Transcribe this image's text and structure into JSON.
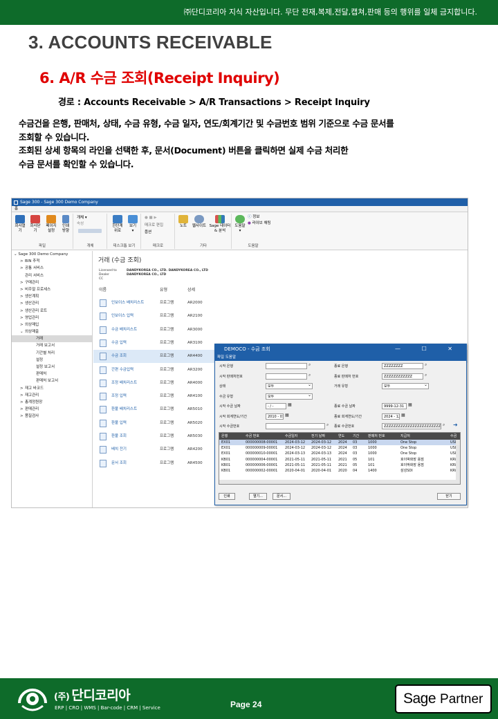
{
  "header": {
    "notice": "㈜단디코리아 지식 자산입니다. 무단 전재,복제,전달,캡쳐,판매 등의 행위를 일체 금지합니다.",
    "section_title": "3. ACCOUNTS RECEIVABLE",
    "sub_title": "6. A/R 수금 조회(Receipt Inquiry)",
    "path": "경로 : Accounts Receivable  > A/R Transactions > Receipt Inquiry",
    "description": [
      "수금건을 은행, 판매처, 상태, 수금 유형, 수금 일자, 연도/회계기간 및 수금번호 범위 기준으로 수금 문서를",
      "조회할 수 있습니다.",
      "조회된 상세 항목의 라인을 선택한 후, 문서(Document) 버튼을 클릭하면 실제 수금 처리한",
      "수금 문서를 확인할 수 있습니다."
    ]
  },
  "app": {
    "window_title": "Sage 300 - Sage 300 Demo Company",
    "menu_tab": "홈",
    "ribbon": {
      "buttons": [
        {
          "label": "회사열기"
        },
        {
          "label": "회사닫기"
        },
        {
          "label": "페이지\n설정"
        },
        {
          "label": "인쇄\n방향"
        },
        {
          "label": "개체 ▾"
        },
        {
          "label": "속성"
        },
        {
          "label": "한단계\n위로"
        },
        {
          "label": "보기\n▾"
        },
        {
          "label": "매크로 편집"
        },
        {
          "label": "옵션"
        },
        {
          "label": "노트"
        },
        {
          "label": "웹사이트"
        },
        {
          "label": "Sage 데이터\n& 분석"
        },
        {
          "label": "도움말\n▾"
        },
        {
          "label": "정보"
        },
        {
          "label": "라이브 채팅"
        }
      ],
      "groups": [
        "파일",
        "개체",
        "데스크톱 보기",
        "매크로",
        "기타",
        "도움말"
      ]
    },
    "tree": {
      "root": "Sage 300 Demo Company",
      "items": [
        {
          "label": "BIN 추적",
          "level": 1,
          "expand": ">"
        },
        {
          "label": "공통 서비스",
          "level": 1,
          "expand": ">"
        },
        {
          "label": "관리 서비스",
          "level": 1,
          "expand": ""
        },
        {
          "label": "구매관리",
          "level": 1,
          "expand": ">"
        },
        {
          "label": "비주얼 프로세스",
          "level": 1,
          "expand": ">"
        },
        {
          "label": "생산계획",
          "level": 1,
          "expand": ">"
        },
        {
          "label": "생산관리",
          "level": 1,
          "expand": ">"
        },
        {
          "label": "생산관리 로트",
          "level": 1,
          "expand": ">"
        },
        {
          "label": "영업관리",
          "level": 1,
          "expand": ">"
        },
        {
          "label": "외상매입",
          "level": 1,
          "expand": ">"
        },
        {
          "label": "외상매출",
          "level": 1,
          "expand": "⌄"
        },
        {
          "label": "거래",
          "level": 2,
          "expand": "",
          "selected": true
        },
        {
          "label": "거래 보고서",
          "level": 2,
          "expand": ""
        },
        {
          "label": "기간별 처리",
          "level": 2,
          "expand": ""
        },
        {
          "label": "설정",
          "level": 2,
          "expand": ""
        },
        {
          "label": "설정 보고서",
          "level": 2,
          "expand": ""
        },
        {
          "label": "판매처",
          "level": 2,
          "expand": ""
        },
        {
          "label": "판매처 보고서",
          "level": 2,
          "expand": ""
        },
        {
          "label": "재고 바코드",
          "level": 1,
          "expand": ">"
        },
        {
          "label": "재고관리",
          "level": 1,
          "expand": ">"
        },
        {
          "label": "총계정원장",
          "level": 1,
          "expand": ">"
        },
        {
          "label": "판매관리",
          "level": 1,
          "expand": ">"
        },
        {
          "label": "품질검사",
          "level": 1,
          "expand": ">"
        }
      ]
    },
    "main": {
      "title": "거래 (수금 조회)",
      "license": [
        {
          "k": "Licensed to",
          "v": "DANDYKOREA CO., LTD. DANDYKOREA CO., LTD"
        },
        {
          "k": "Dealer",
          "v": "DANDYKOREA CO., LTD"
        },
        {
          "k": "CC",
          "v": ""
        }
      ],
      "columns": {
        "name": "이름",
        "type": "유형",
        "detail": "상세"
      },
      "programs": [
        {
          "name": "인보이스 배치리스트",
          "type": "프로그램",
          "code": "AR2000"
        },
        {
          "name": "인보이스 입력",
          "type": "프로그램",
          "code": "AR2100"
        },
        {
          "name": "수금 배치리스트",
          "type": "프로그램",
          "code": "AR3000"
        },
        {
          "name": "수금 입력",
          "type": "프로그램",
          "code": "AR3100"
        },
        {
          "name": "수금 조회",
          "type": "프로그램",
          "code": "AR4400",
          "selected": true
        },
        {
          "name": "간편 수금입력",
          "type": "프로그램",
          "code": "AR3200"
        },
        {
          "name": "조정 배치리스트",
          "type": "프로그램",
          "code": "AR4000"
        },
        {
          "name": "조정 입력",
          "type": "프로그램",
          "code": "AR4100"
        },
        {
          "name": "환불 배치리스트",
          "type": "프로그램",
          "code": "AR5010"
        },
        {
          "name": "환불 입력",
          "type": "프로그램",
          "code": "AR5020"
        },
        {
          "name": "환불 조회",
          "type": "프로그램",
          "code": "AR5030"
        },
        {
          "name": "배치 전기",
          "type": "프로그램",
          "code": "AR4200"
        },
        {
          "name": "문서 조회",
          "type": "프로그램",
          "code": "AR4500"
        }
      ]
    },
    "dialog": {
      "title": "DEMOCO - 수금 조회",
      "menu": "파일 도움말",
      "controls": "—  ☐  ✕",
      "fields": {
        "from_bank_label": "시작 은행",
        "to_bank_label": "종료 은행",
        "to_bank_value": "ZZZZZZZZ",
        "from_customer_label": "시작 판매처번호",
        "to_customer_label": "종료 판매처 번호",
        "to_customer_value": "ZZZZZZZZZZZZ",
        "status_label": "상태",
        "status_value": "모두",
        "txn_type_label": "거래 유형",
        "txn_type_value": "모두",
        "receipt_type_label": "수금 유형",
        "receipt_type_value": "모두",
        "from_date_label": "시작 수금 날짜",
        "from_date_value": "- / -",
        "to_date_label": "종료 수금 날짜",
        "to_date_value": "9999-12-31",
        "from_period_label": "시작 회계연도/기간",
        "from_period_value": "2010 - 01",
        "to_period_label": "종료 회계연도/기간",
        "to_period_value": "2024 - 12",
        "from_receipt_label": "시작 수금번호",
        "to_receipt_label": "종료 수금번호",
        "to_receipt_value": "ZZZZZZZZZZZZZZZZZZZZZZZZ"
      },
      "grid": {
        "headers": [
          "은행",
          "수금 번호",
          "수금일자",
          "전기 날짜",
          "연도",
          "기간",
          "판매처 번호",
          "지급처",
          "수금"
        ],
        "rows": [
          [
            "EX01",
            "000000008-00001",
            "2024-03-12",
            "2024-03-12",
            "2024",
            "03",
            "1000",
            "One Stop",
            "USD"
          ],
          [
            "EX01",
            "000000009-00001",
            "2024-03-12",
            "2024-03-12",
            "2024",
            "03",
            "1000",
            "One Stop",
            "USD"
          ],
          [
            "EX01",
            "000000010-00001",
            "2024-03-13",
            "2024-03-13",
            "2024",
            "03",
            "1000",
            "One Stop",
            "USD"
          ],
          [
            "KB01",
            "000000004-00001",
            "2021-05-11",
            "2021-05-11",
            "2021",
            "05",
            "101",
            "호이박화장 용점",
            "KRW"
          ],
          [
            "KB01",
            "000000006-00001",
            "2021-05-11",
            "2021-05-11",
            "2021",
            "05",
            "101",
            "호이박화장 용점",
            "KRW"
          ],
          [
            "KB01",
            "000000002-00001",
            "2020-04-01",
            "2020-04-01",
            "2020",
            "04",
            "1400",
            "삼성SDI",
            "KRW"
          ]
        ]
      },
      "buttons": {
        "print": "인쇄",
        "columns": "열기...",
        "document": "문서...",
        "close": "닫기"
      }
    }
  },
  "footer": {
    "company_prefix": "(주)",
    "company": "단디코리아",
    "company_sub": "ERP | CRO | WMS | Bar-code | CRM | Service",
    "page": "Page 24",
    "partner_brand": "Sage",
    "partner_label": "Partner"
  },
  "colors": {
    "brand_green": "#0e6b2a",
    "title_red": "#e00000",
    "app_blue": "#1f5fa8"
  }
}
